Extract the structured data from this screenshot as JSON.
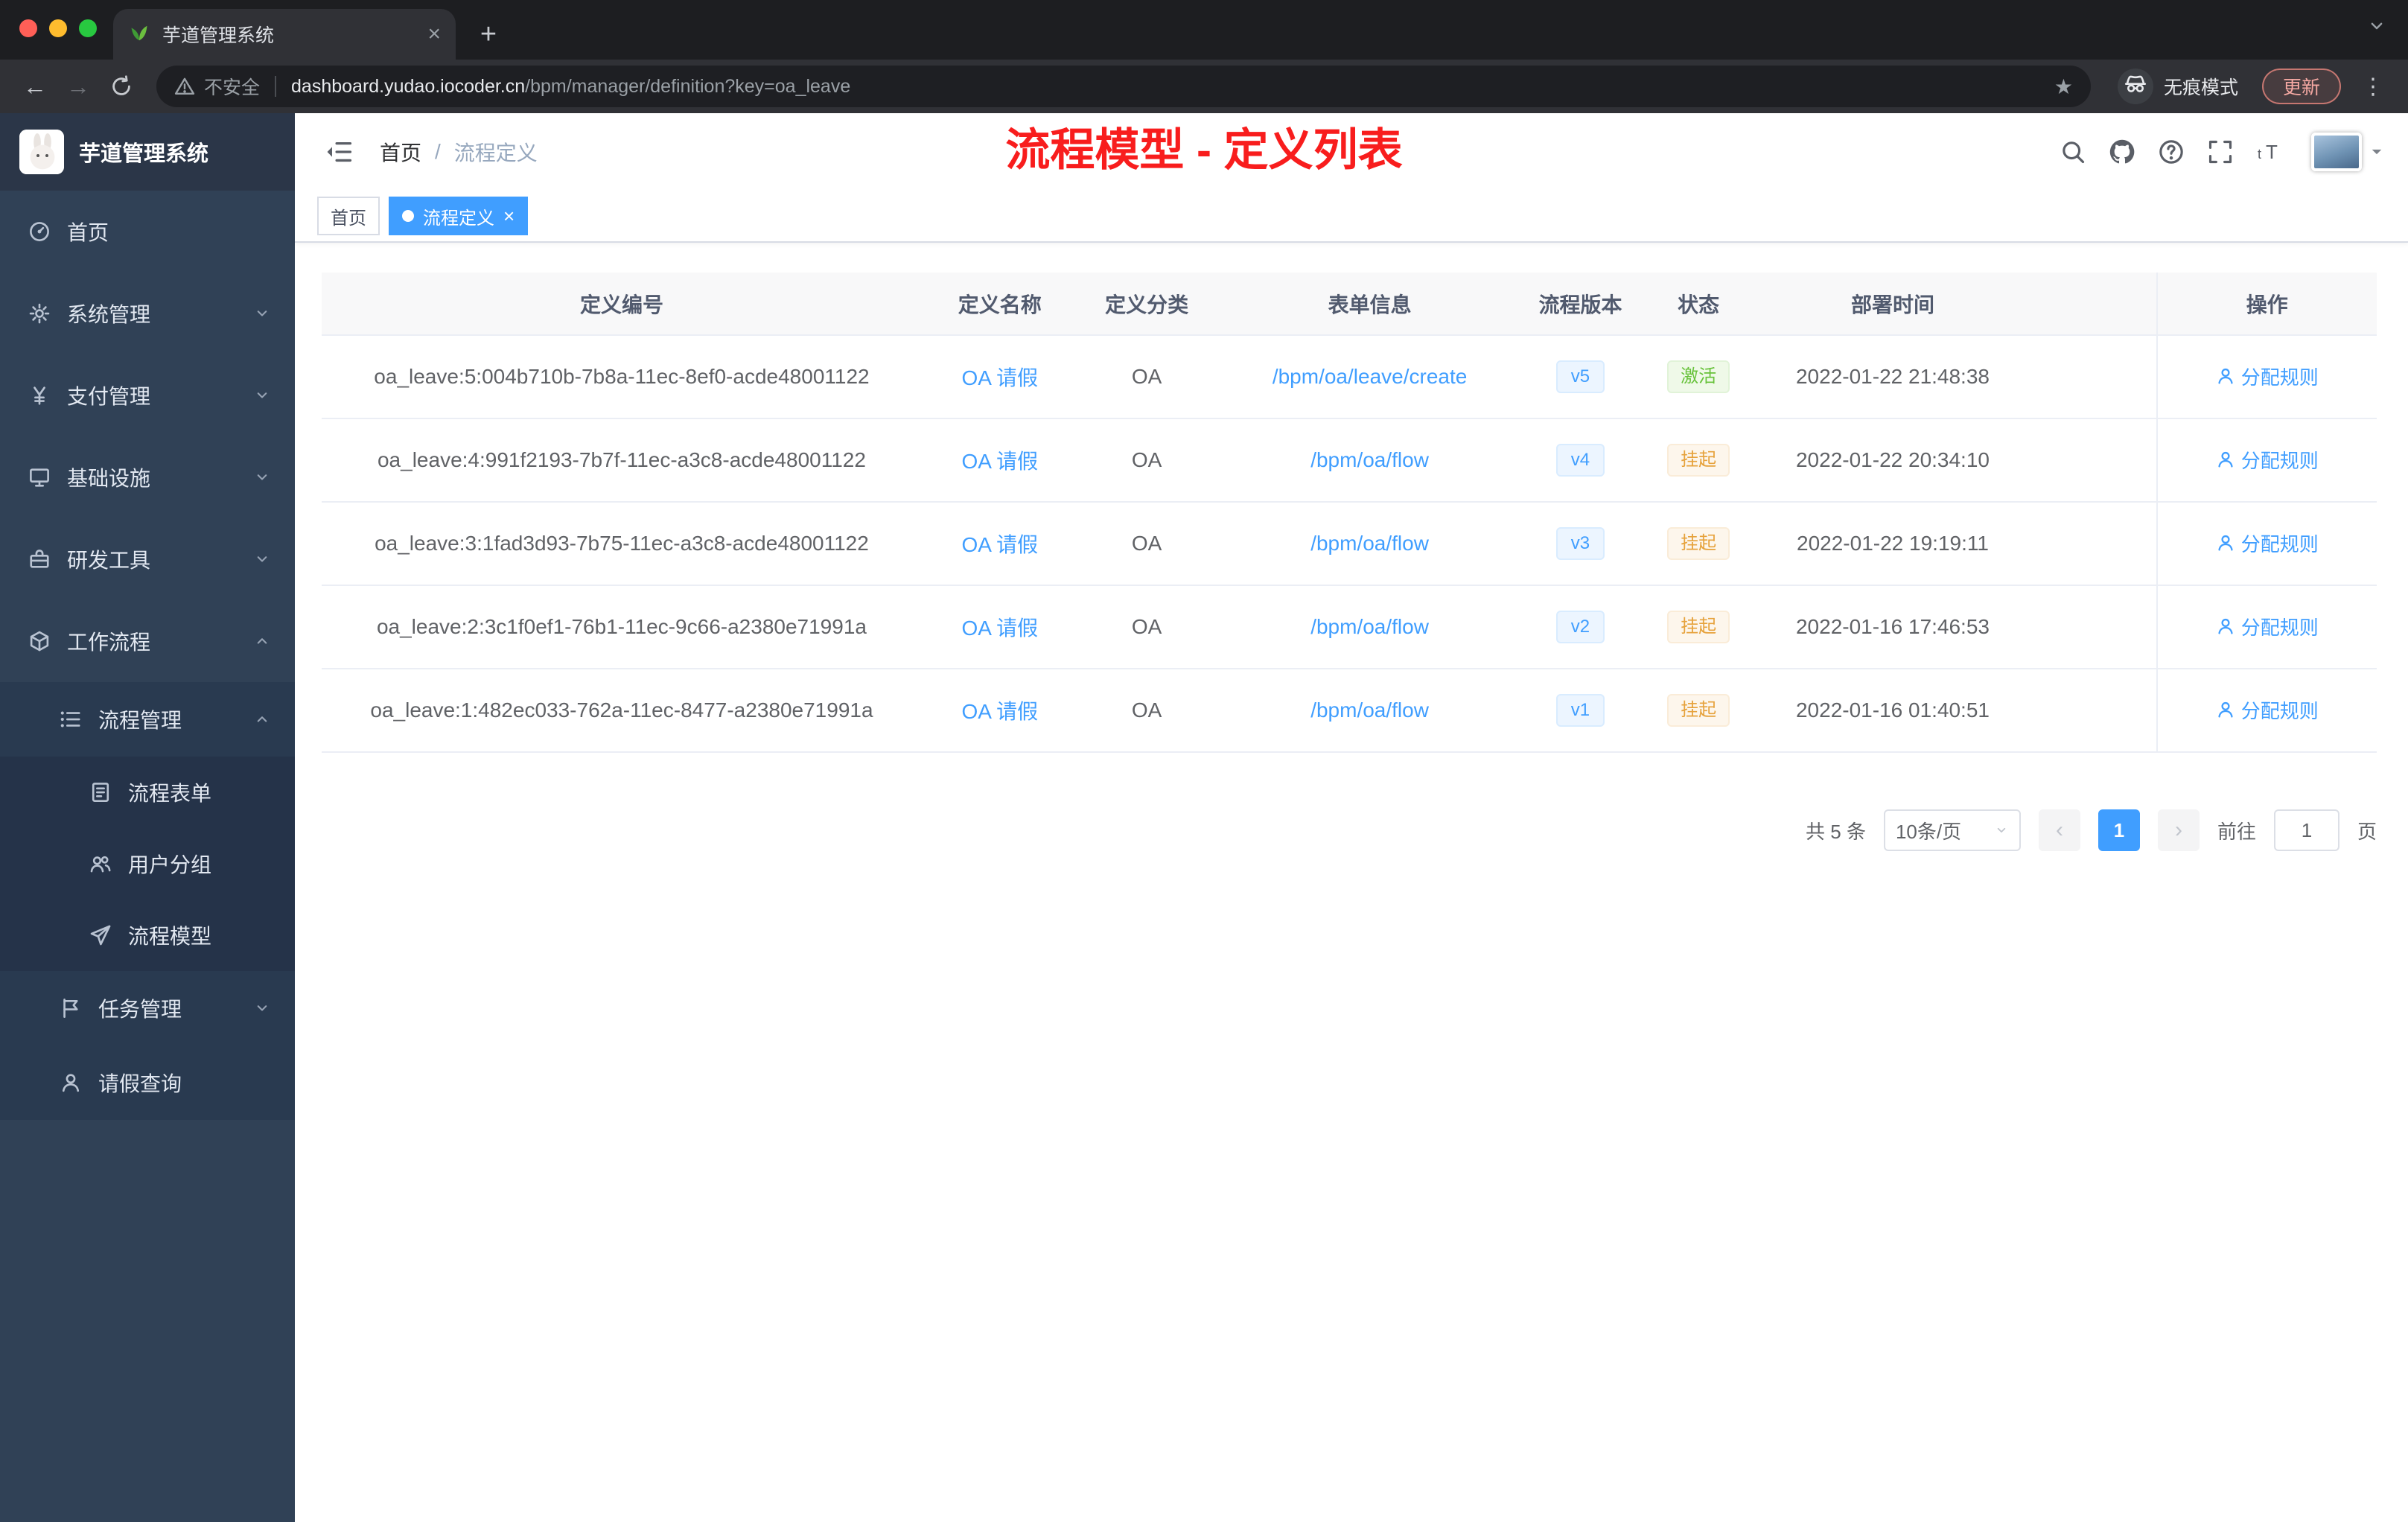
{
  "colors": {
    "accent": "#409eff",
    "success": "#67c23a",
    "warning": "#e6a23c",
    "annotation": "#f81d1d",
    "frame": "#1d1e21",
    "toolbar": "#303136",
    "sidebar_bg": "#304156",
    "sidebar_sub_bg": "#293a50",
    "sidebar_sub2_bg": "#253349"
  },
  "browser": {
    "tab_title": "芋道管理系统",
    "favicon": "sprout-icon",
    "security_label": "不安全",
    "url_host": "dashboard.yudao.iocoder.cn",
    "url_path": "/bpm/manager/definition?key=oa_leave",
    "omnibox_icons": [
      "key-icon",
      "star-icon"
    ],
    "incognito_label": "无痕模式",
    "update_label": "更新"
  },
  "sidebar": {
    "logo_title": "芋道管理系统",
    "items": [
      {
        "key": "home",
        "label": "首页",
        "icon": "dashboard-icon",
        "level": 1,
        "arrow": null
      },
      {
        "key": "system-management",
        "label": "系统管理",
        "icon": "gear-icon",
        "level": 1,
        "arrow": "down"
      },
      {
        "key": "payment-management",
        "label": "支付管理",
        "icon": "yen-icon",
        "level": 1,
        "arrow": "down"
      },
      {
        "key": "infrastructure",
        "label": "基础设施",
        "icon": "monitor-icon",
        "level": 1,
        "arrow": "down"
      },
      {
        "key": "dev-tools",
        "label": "研发工具",
        "icon": "toolbox-icon",
        "level": 1,
        "arrow": "down"
      },
      {
        "key": "workflow",
        "label": "工作流程",
        "icon": "workflow-icon",
        "level": 1,
        "arrow": "up"
      },
      {
        "key": "process-management",
        "label": "流程管理",
        "icon": "list-icon",
        "level": 2,
        "arrow": "up"
      },
      {
        "key": "process-form",
        "label": "流程表单",
        "icon": "form-icon",
        "level": 3,
        "arrow": null
      },
      {
        "key": "user-group",
        "label": "用户分组",
        "icon": "users-icon",
        "level": 3,
        "arrow": null
      },
      {
        "key": "process-model",
        "label": "流程模型",
        "icon": "send-icon",
        "level": 3,
        "arrow": null
      },
      {
        "key": "task-management",
        "label": "任务管理",
        "icon": "tasks-icon",
        "level": 2,
        "arrow": "down"
      },
      {
        "key": "leave-query",
        "label": "请假查询",
        "icon": "user-icon",
        "level": 2,
        "arrow": null
      }
    ]
  },
  "header": {
    "breadcrumb": [
      "首页",
      "流程定义"
    ],
    "breadcrumb_separator": "/",
    "annotation": "流程模型 - 定义列表",
    "action_icons": [
      "search-icon",
      "github-icon",
      "question-icon",
      "fullscreen-icon",
      "fontsize-icon"
    ]
  },
  "tags": [
    {
      "key": "home",
      "label": "首页",
      "active": false,
      "closable": false
    },
    {
      "key": "process-definition",
      "label": "流程定义",
      "active": true,
      "closable": true
    }
  ],
  "table": {
    "columns": [
      "定义编号",
      "定义名称",
      "定义分类",
      "表单信息",
      "流程版本",
      "状态",
      "部署时间",
      "操作"
    ],
    "rows": [
      {
        "id": "oa_leave:5:004b710b-7b8a-11ec-8ef0-acde48001122",
        "name": "OA 请假",
        "category": "OA",
        "form": "/bpm/oa/leave/create",
        "version": "v5",
        "status": "激活",
        "status_type": "success",
        "deploy_time": "2022-01-22 21:48:38",
        "action": "分配规则"
      },
      {
        "id": "oa_leave:4:991f2193-7b7f-11ec-a3c8-acde48001122",
        "name": "OA 请假",
        "category": "OA",
        "form": "/bpm/oa/flow",
        "version": "v4",
        "status": "挂起",
        "status_type": "warning",
        "deploy_time": "2022-01-22 20:34:10",
        "action": "分配规则"
      },
      {
        "id": "oa_leave:3:1fad3d93-7b75-11ec-a3c8-acde48001122",
        "name": "OA 请假",
        "category": "OA",
        "form": "/bpm/oa/flow",
        "version": "v3",
        "status": "挂起",
        "status_type": "warning",
        "deploy_time": "2022-01-22 19:19:11",
        "action": "分配规则"
      },
      {
        "id": "oa_leave:2:3c1f0ef1-76b1-11ec-9c66-a2380e71991a",
        "name": "OA 请假",
        "category": "OA",
        "form": "/bpm/oa/flow",
        "version": "v2",
        "status": "挂起",
        "status_type": "warning",
        "deploy_time": "2022-01-16 17:46:53",
        "action": "分配规则"
      },
      {
        "id": "oa_leave:1:482ec033-762a-11ec-8477-a2380e71991a",
        "name": "OA 请假",
        "category": "OA",
        "form": "/bpm/oa/flow",
        "version": "v1",
        "status": "挂起",
        "status_type": "warning",
        "deploy_time": "2022-01-16 01:40:51",
        "action": "分配规则"
      }
    ]
  },
  "pagination": {
    "total_label": "共 5 条",
    "page_size_label": "10条/页",
    "current_page": "1",
    "goto_label": "前往",
    "goto_value": "1",
    "page_unit": "页"
  }
}
